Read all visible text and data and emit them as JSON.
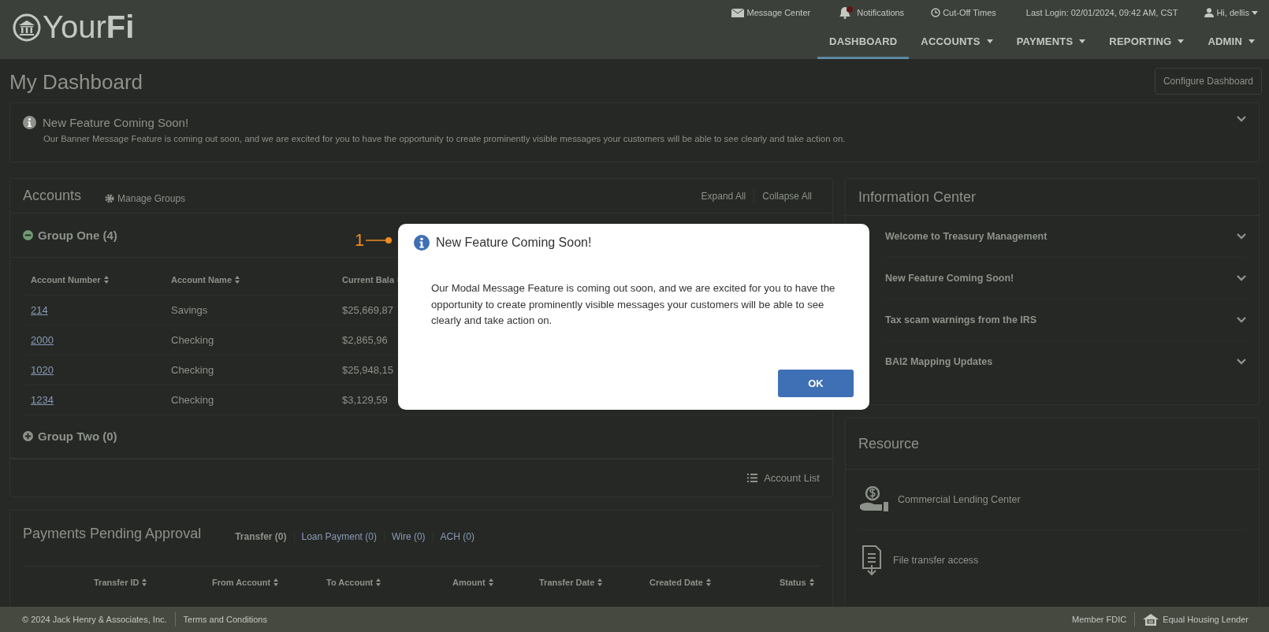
{
  "header": {
    "logo_plain": "Your",
    "logo_bold": "Fi",
    "top_links": [
      {
        "kind": "mail",
        "label": "Message Center"
      },
      {
        "kind": "bell",
        "label": "Notifications"
      },
      {
        "kind": "clock",
        "label": "Cut-Off Times"
      },
      {
        "kind": "text",
        "label": "Last Login: 02/01/2024, 09:42 AM, CST"
      },
      {
        "kind": "user",
        "label": "Hi, dellis"
      }
    ],
    "nav": [
      {
        "label": "DASHBOARD",
        "selected": true,
        "dropdown": false
      },
      {
        "label": "ACCOUNTS",
        "selected": false,
        "dropdown": true
      },
      {
        "label": "PAYMENTS",
        "selected": false,
        "dropdown": true
      },
      {
        "label": "REPORTING",
        "selected": false,
        "dropdown": true
      },
      {
        "label": "ADMIN",
        "selected": false,
        "dropdown": true
      }
    ]
  },
  "page_title": "My Dashboard",
  "configure_button": "Configure Dashboard",
  "banner": {
    "title": "New Feature Coming Soon!",
    "message": "Our Banner Message Feature is coming out soon, and we are excited for you to have the opportunity to create prominently visible messages your customers will be able to see clearly and take action on."
  },
  "accounts": {
    "title": "Accounts",
    "manage_groups": "Manage Groups",
    "expand_all": "Expand All",
    "collapse_all": "Collapse All",
    "groups": [
      {
        "label": "Group One (4)",
        "expanded": true,
        "columns": [
          "Account Number",
          "Account Name",
          "Current Bala"
        ],
        "rows": [
          [
            "214",
            "Savings",
            "$25,669,87"
          ],
          [
            "2000",
            "Checking",
            "$2,865,96"
          ],
          [
            "1020",
            "Checking",
            "$25,948,15"
          ],
          [
            "1234",
            "Checking",
            "$3,129,59"
          ]
        ]
      },
      {
        "label": "Group Two (0)",
        "expanded": false
      }
    ],
    "account_list": "Account List"
  },
  "info_center": {
    "title": "Information Center",
    "items": [
      "Welcome to Treasury Management",
      "New Feature Coming Soon!",
      "Tax scam warnings from the IRS",
      "BAI2 Mapping Updates"
    ]
  },
  "resource": {
    "title": "Resource",
    "items": [
      {
        "kind": "lending",
        "label": "Commercial Lending Center"
      },
      {
        "kind": "file",
        "label": "File transfer access"
      }
    ]
  },
  "payments": {
    "title": "Payments Pending Approval",
    "tabs": [
      {
        "label": "Transfer (0)",
        "selected": true
      },
      {
        "label": "Loan Payment (0)",
        "selected": false
      },
      {
        "label": "Wire (0)",
        "selected": false
      },
      {
        "label": "ACH (0)",
        "selected": false
      }
    ],
    "columns": [
      "Transfer ID",
      "From Account",
      "To Account",
      "Amount",
      "Transfer Date",
      "Created Date",
      "Status"
    ]
  },
  "footer": {
    "copyright": "© 2024 Jack Henry & Associates, Inc.",
    "terms": "Terms and Conditions",
    "member_fdic": "Member FDIC",
    "equal_housing": "Equal Housing Lender"
  },
  "modal": {
    "title": "New Feature Coming Soon!",
    "message": "Our Modal Message Feature is coming out soon, and we are excited for you to have the opportunity to create prominently visible messages your customers will be able to see clearly and take action on.",
    "ok": "OK"
  },
  "callout": {
    "label": "1"
  }
}
